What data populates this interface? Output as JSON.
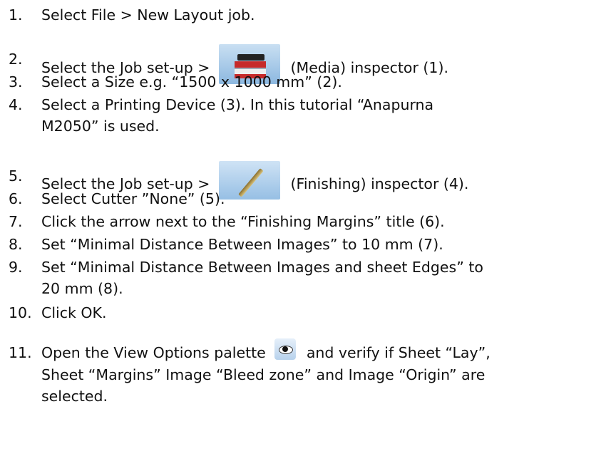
{
  "steps": [
    {
      "num": "1.",
      "text": "Select File > New Layout job."
    },
    {
      "num": "2.",
      "before": "Select the Job set-up >",
      "icon": "media-inspector-icon",
      "after": "(Media) inspector (1)."
    },
    {
      "num": "3.",
      "text": "Select a Size e.g. “1500 x 1000 mm” (2)."
    },
    {
      "num": "4.",
      "line1": "Select a Printing Device (3). In this tutorial “Anapurna",
      "line2": "M2050” is used."
    },
    {
      "num": "5.",
      "before": "Select the Job set-up >",
      "icon": "finishing-inspector-icon",
      "after": "(Finishing) inspector (4)."
    },
    {
      "num": "6.",
      "text": "Select Cutter ”None” (5)."
    },
    {
      "num": "7.",
      "text": "Click the arrow next to the “Finishing Margins” title (6)."
    },
    {
      "num": "8.",
      "text": "Set “Minimal Distance Between Images” to 10 mm (7)."
    },
    {
      "num": "9.",
      "line1": "Set “Minimal Distance Between Images and sheet Edges” to",
      "line2": "20 mm (8)."
    },
    {
      "num": "10.",
      "text": "Click OK."
    },
    {
      "num": "11.",
      "before": "Open the View Options palette",
      "icon": "eye-icon",
      "after": "and verify if Sheet “Lay”,",
      "line2": "Sheet “Margins” Image “Bleed zone” and Image “Origin” are",
      "line3": "selected."
    }
  ]
}
